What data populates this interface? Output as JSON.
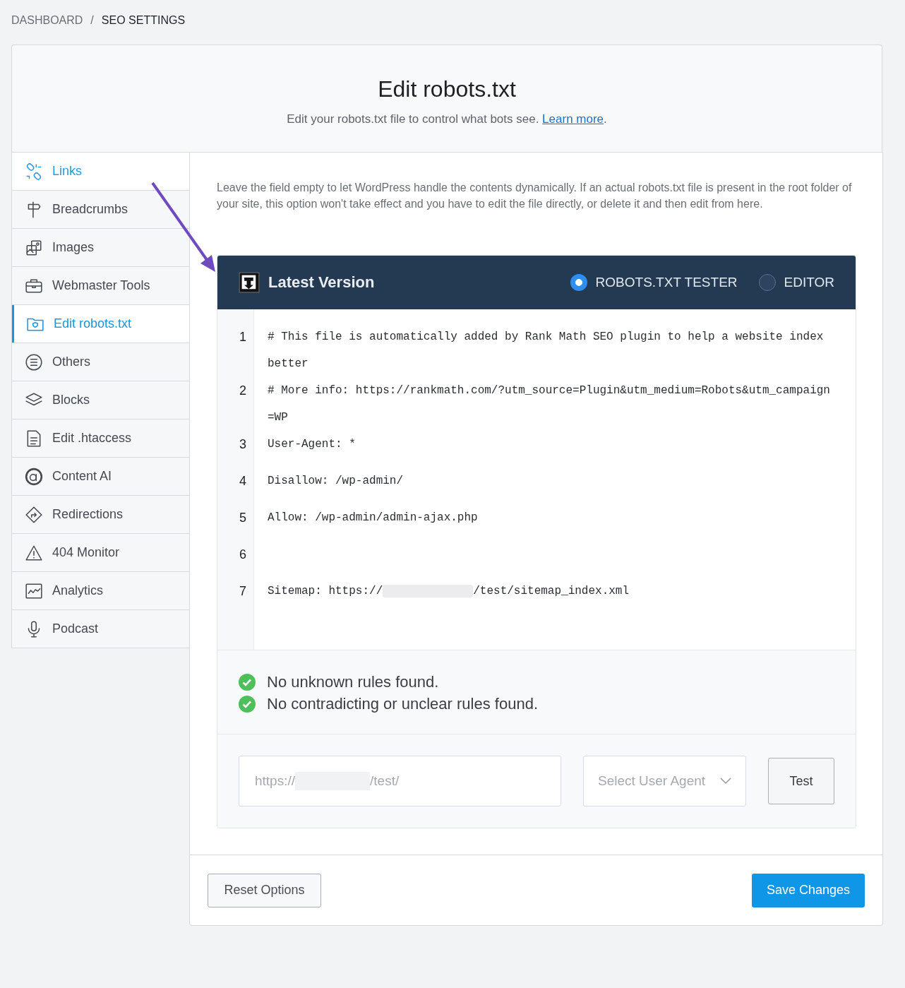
{
  "breadcrumb": {
    "items": [
      {
        "label": "DASHBOARD",
        "current": false
      },
      {
        "label": "SEO SETTINGS",
        "current": true
      }
    ],
    "separator": "/"
  },
  "header": {
    "title": "Edit robots.txt",
    "description": "Edit your robots.txt file to control what bots see.",
    "link": "Learn more",
    "trailing": "."
  },
  "sidebar": {
    "items": [
      {
        "label": "Links",
        "selected": false,
        "hover": true
      },
      {
        "label": "Breadcrumbs",
        "selected": false,
        "hover": false
      },
      {
        "label": "Images",
        "selected": false,
        "hover": false
      },
      {
        "label": "Webmaster Tools",
        "selected": false,
        "hover": false
      },
      {
        "label": "Edit robots.txt",
        "selected": true,
        "hover": false
      },
      {
        "label": "Others",
        "selected": false,
        "hover": false
      },
      {
        "label": "Blocks",
        "selected": false,
        "hover": false
      },
      {
        "label": "Edit .htaccess",
        "selected": false,
        "hover": false
      },
      {
        "label": "Content AI",
        "selected": false,
        "hover": false
      },
      {
        "label": "Redirections",
        "selected": false,
        "hover": false
      },
      {
        "label": "404 Monitor",
        "selected": false,
        "hover": false
      },
      {
        "label": "Analytics",
        "selected": false,
        "hover": false
      },
      {
        "label": "Podcast",
        "selected": false,
        "hover": false
      }
    ]
  },
  "notice": "Leave the field empty to let WordPress handle the contents dynamically. If an actual robots.txt file is present in the root folder of your site, this option won't take effect and you have to edit the file directly, or delete it and then edit from here.",
  "tester": {
    "title": "Latest Version",
    "modes": [
      {
        "label": "ROBOTS.TXT TESTER",
        "selected": true
      },
      {
        "label": "EDITOR",
        "selected": false
      }
    ],
    "lines": [
      {
        "number": "1",
        "parts": [
          {
            "kind": "text",
            "text": "# This file is automatically added by Rank Math SEO plugin to help a website index better"
          }
        ]
      },
      {
        "number": "2",
        "parts": [
          {
            "kind": "text",
            "text": "# More info: https://rankmath.com/?utm_source=Plugin&utm_medium=Robots&utm_campaign=WP"
          }
        ]
      },
      {
        "number": "3",
        "parts": [
          {
            "kind": "text",
            "text": "User-Agent: *"
          }
        ]
      },
      {
        "number": "4",
        "parts": [
          {
            "kind": "text",
            "text": "Disallow: /wp-admin/"
          }
        ]
      },
      {
        "number": "5",
        "parts": [
          {
            "kind": "text",
            "text": "Allow: /wp-admin/admin-ajax.php"
          }
        ]
      },
      {
        "number": "6"
      },
      {
        "number": "7",
        "parts": [
          {
            "kind": "text",
            "text": "Sitemap: https://"
          },
          {
            "kind": "redacted"
          },
          {
            "kind": "text",
            "text": "/test/sitemap_index.xml"
          }
        ]
      }
    ],
    "results": [
      {
        "text": "No unknown rules found.",
        "ok": true
      },
      {
        "text": "No contradicting or unclear rules found.",
        "ok": true
      }
    ],
    "url_field": {
      "parts": [
        {
          "kind": "text",
          "text": "https://"
        },
        {
          "kind": "redacted"
        },
        {
          "kind": "text",
          "text": "/test/"
        }
      ]
    },
    "agent_select": {
      "placeholder": "Select User Agent"
    },
    "test_button": "Test"
  },
  "footer": {
    "reset_button": "Reset Options",
    "save_button": "Save Changes"
  }
}
